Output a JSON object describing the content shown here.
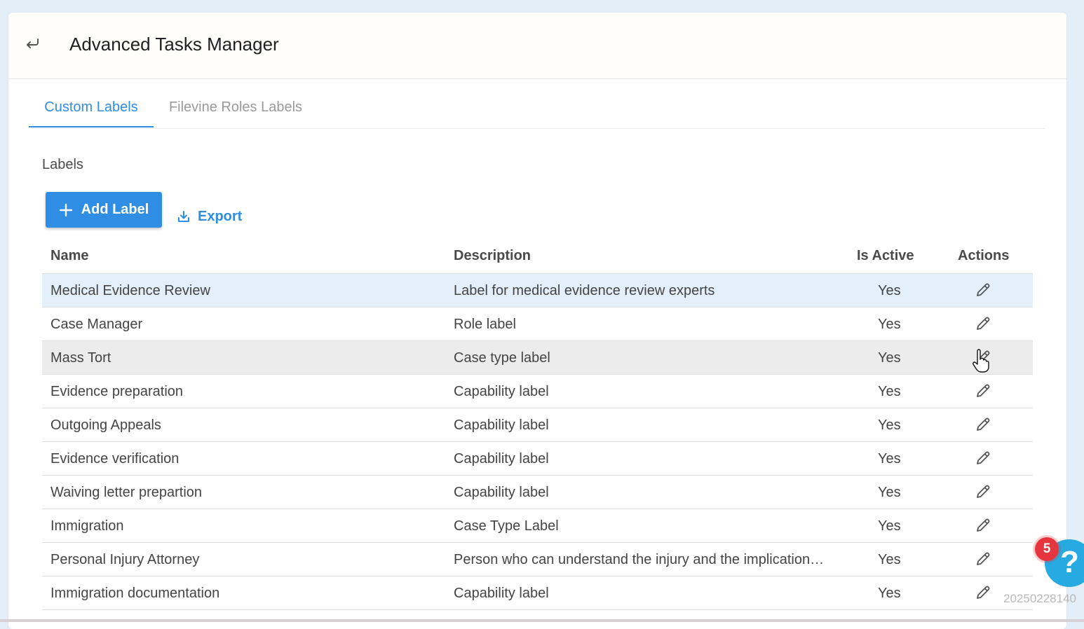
{
  "header": {
    "title": "Advanced Tasks Manager",
    "back_icon": "back-arrow-icon"
  },
  "tabs": [
    {
      "label": "Custom Labels",
      "active": true
    },
    {
      "label": "Filevine Roles Labels",
      "active": false
    }
  ],
  "section": {
    "title": "Labels"
  },
  "toolbar": {
    "add_label": "Add Label",
    "export_label": "Export"
  },
  "table": {
    "columns": {
      "name": "Name",
      "description": "Description",
      "is_active": "Is Active",
      "actions": "Actions"
    },
    "rows": [
      {
        "name": "Medical Evidence Review",
        "description": "Label for medical evidence review experts",
        "is_active": "Yes"
      },
      {
        "name": "Case Manager",
        "description": "Role label",
        "is_active": "Yes"
      },
      {
        "name": "Mass Tort",
        "description": "Case type label",
        "is_active": "Yes"
      },
      {
        "name": "Evidence preparation",
        "description": "Capability label",
        "is_active": "Yes"
      },
      {
        "name": "Outgoing Appeals",
        "description": "Capability label",
        "is_active": "Yes"
      },
      {
        "name": "Evidence verification",
        "description": "Capability label",
        "is_active": "Yes"
      },
      {
        "name": "Waiving letter prepartion",
        "description": "Capability label",
        "is_active": "Yes"
      },
      {
        "name": "Immigration",
        "description": "Case Type Label",
        "is_active": "Yes"
      },
      {
        "name": "Personal Injury Attorney",
        "description": "Person who can understand the injury and the implication…",
        "is_active": "Yes"
      },
      {
        "name": "Immigration documentation",
        "description": "Capability label",
        "is_active": "Yes"
      }
    ]
  },
  "help": {
    "badge_count": "5",
    "symbol": "?"
  },
  "stamp": "20250228140",
  "colors": {
    "accent": "#2f8de4",
    "selected_row": "#e3effb",
    "hover_row": "#ececec",
    "badge": "#e5363f",
    "help": "#27a9e1"
  }
}
